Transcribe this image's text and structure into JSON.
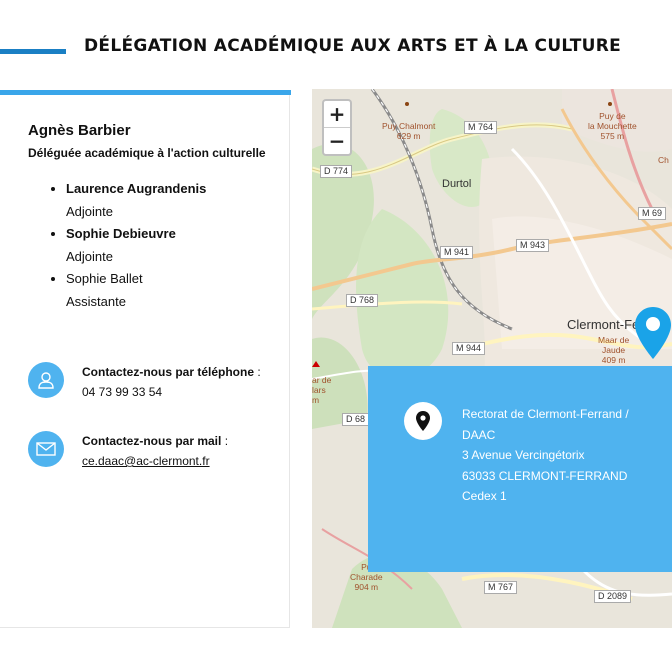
{
  "header": {
    "title": "DÉLÉGATION ACADÉMIQUE AUX ARTS ET À LA CULTURE"
  },
  "person": {
    "name": "Agnès Barbier",
    "role": "Déléguée académique à l'action culturelle"
  },
  "team": [
    {
      "name": "Laurence Augrandenis",
      "role": "Adjointe"
    },
    {
      "name": "Sophie Debieuvre",
      "role": "Adjointe"
    },
    {
      "name": "Sophie Ballet",
      "role": "Assistante"
    }
  ],
  "contact": {
    "phone_label": "Contactez-nous par téléphone",
    "phone_value": "04 73 99 33 54",
    "mail_label": "Contactez-nous par mail",
    "mail_value": "ce.daac@ac-clermont.fr",
    "separator": " :"
  },
  "map": {
    "zoom_in": "+",
    "zoom_out": "−",
    "labels": {
      "puy_chalmont": "Puy Chalmont\n629 m",
      "puy_mouchette": "Puy de\nla Mouchette\n575 m",
      "durtol": "Durtol",
      "clermont": "Clermont-Fe",
      "maar": "Maar de\nJaude\n409 m",
      "puy_charade": "Pu\nCharade\n904 m",
      "mar_de": "ar de\nlars\nm",
      "ch": "Ch"
    },
    "roads": [
      "M 764",
      "D 774",
      "M 69",
      "M 943",
      "M 941",
      "D 768",
      "M 944",
      "D 68",
      "M 767",
      "D 2089"
    ]
  },
  "address": {
    "lines": [
      "Rectorat de Clermont-Ferrand /",
      "DAAC",
      "3 Avenue Vercingétorix",
      "63033 CLERMONT-FERRAND",
      "Cedex 1"
    ]
  },
  "colors": {
    "accent": "#4fb3ef",
    "title_bar": "#1a7fc4",
    "card_bar": "#3aa6ea"
  },
  "icons": {
    "phone": "person-headset-icon",
    "mail": "envelope-icon",
    "address": "map-pin-icon",
    "marker": "map-marker-icon"
  }
}
